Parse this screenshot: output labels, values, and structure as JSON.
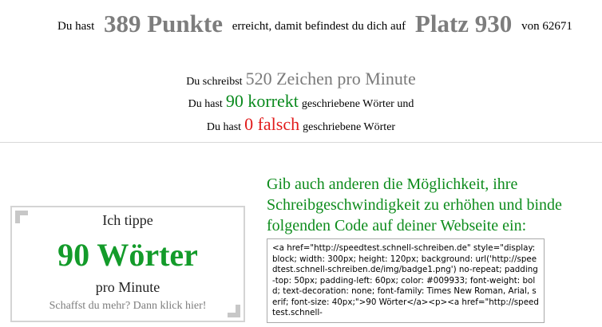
{
  "result": {
    "prefix": "Du hast",
    "points": "389 Punkte",
    "middle": "erreicht, damit befindest du dich auf",
    "place": "Platz 930",
    "of_total": "von 62671"
  },
  "speed": {
    "prefix": "Du schreibst",
    "value": "520 Zeichen pro Minute",
    "correct_prefix": "Du hast",
    "correct_value": "90 korrekt",
    "correct_suffix": "geschriebene Wörter und",
    "wrong_prefix": "Du hast",
    "wrong_value": "0 falsch",
    "wrong_suffix": "geschriebene Wörter"
  },
  "badge": {
    "title": "Ich tippe",
    "words": "90 Wörter",
    "per": "pro Minute",
    "cta": "Schaffst du mehr? Dann klick hier!"
  },
  "share": {
    "invite": "Gib auch anderen die Möglichkeit, ihre Schreibgeschwindigkeit zu erhöhen und binde folgenden Code auf deiner Webseite ein:",
    "code": "<a href=\"http://speedtest.schnell-schreiben.de\" style=\"display: block; width: 300px; height: 120px; background: url('http://speedtest.schnell-schreiben.de/img/badge1.png') no-repeat; padding-top: 50px; padding-left: 60px; color: #009933; font-weight: bold; text-decoration: none; font-family: Times New Roman, Arial, serif; font-size: 40px;\">90 Wörter</a><p><a href=\"http://speedtest.schnell-"
  },
  "colors": {
    "correct": "#0a8a1e",
    "wrong": "#e11b1b",
    "highlight_gray": "#7d7d7d",
    "invite_green": "#0e8c1d"
  }
}
